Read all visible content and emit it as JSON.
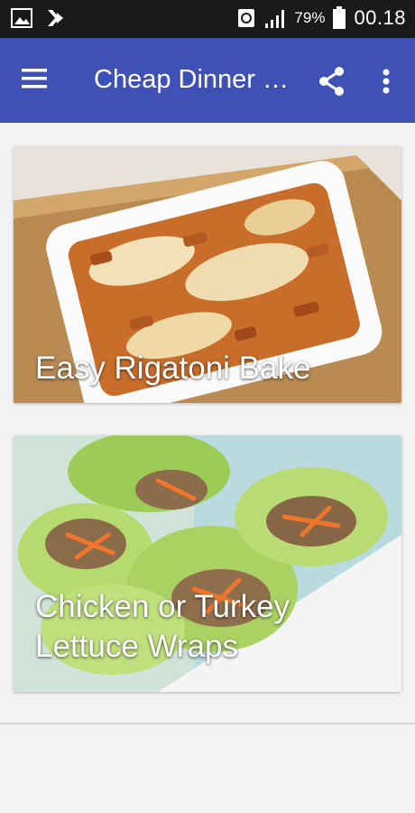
{
  "status_bar": {
    "battery_percent": "79%",
    "time": "00.18",
    "icons": [
      "image-icon",
      "download-icon",
      "sync-icon",
      "signal-icon",
      "battery-icon"
    ]
  },
  "app_bar": {
    "title": "Cheap Dinner Recipes",
    "color": "#3f51b5",
    "icons": [
      "menu-icon",
      "share-icon",
      "more-vert-icon"
    ]
  },
  "recipes": [
    {
      "title": "Easy Rigatoni Bake"
    },
    {
      "title": "Chicken or Turkey Lettuce Wraps"
    }
  ]
}
